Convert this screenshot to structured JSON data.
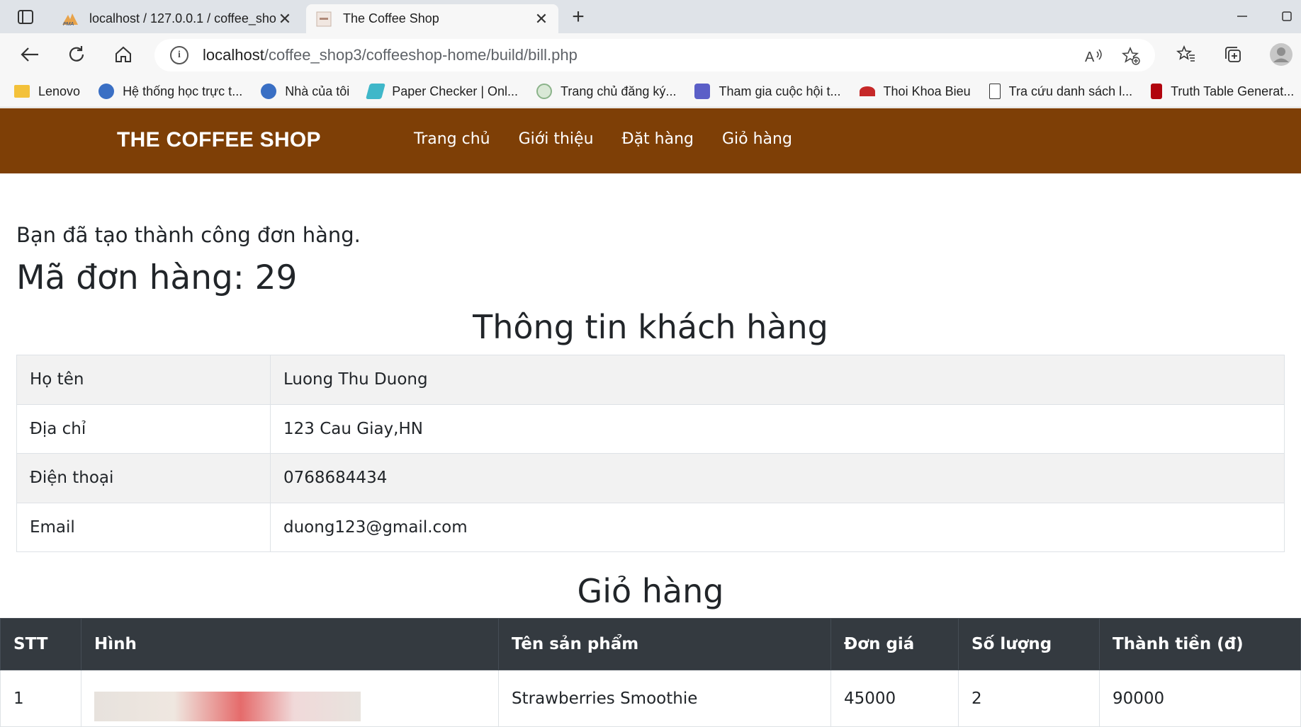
{
  "browser": {
    "tabs": [
      {
        "title": "localhost / 127.0.0.1 / coffee_sho",
        "active": false
      },
      {
        "title": "The Coffee Shop",
        "active": true
      }
    ],
    "url_host": "localhost",
    "url_path": "/coffee_shop3/coffeeshop-home/build/bill.php",
    "bookmarks": [
      {
        "label": "Lenovo",
        "icon": "folder-icon"
      },
      {
        "label": "Hệ thống học trực t...",
        "icon": "globe-icon"
      },
      {
        "label": "Nhà của tôi",
        "icon": "globe-icon"
      },
      {
        "label": "Paper Checker | Onl...",
        "icon": "paper-checker-icon"
      },
      {
        "label": "Trang chủ đăng ký...",
        "icon": "globe-icon"
      },
      {
        "label": "Tham gia cuộc hội t...",
        "icon": "teams-icon"
      },
      {
        "label": "Thoi Khoa Bieu",
        "icon": "red-app-icon"
      },
      {
        "label": "Tra cứu danh sách l...",
        "icon": "page-icon"
      },
      {
        "label": "Truth Table Generat...",
        "icon": "stanford-icon"
      }
    ]
  },
  "site": {
    "brand": "THE COFFEE SHOP",
    "nav": [
      "Trang chủ",
      "Giới thiệu",
      "Đặt hàng",
      "Giỏ hàng"
    ],
    "brand_color": "#7e3f06"
  },
  "bill": {
    "message": "Bạn đã tạo thành công đơn hàng.",
    "order_label": "Mã đơn hàng: 29",
    "customer_heading": "Thông tin khách hàng",
    "customer": [
      {
        "label": "Họ tên",
        "value": "Luong Thu Duong"
      },
      {
        "label": "Địa chỉ",
        "value": "123 Cau Giay,HN"
      },
      {
        "label": "Điện thoại",
        "value": "0768684434"
      },
      {
        "label": "Email",
        "value": "duong123@gmail.com"
      }
    ],
    "cart_heading": "Giỏ hàng",
    "cart_columns": [
      "STT",
      "Hình",
      "Tên sản phẩm",
      "Đơn giá",
      "Số lượng",
      "Thành tiền (đ)"
    ],
    "cart_rows": [
      {
        "stt": "1",
        "name": "Strawberries Smoothie",
        "price": "45000",
        "qty": "2",
        "total": "90000"
      }
    ]
  }
}
